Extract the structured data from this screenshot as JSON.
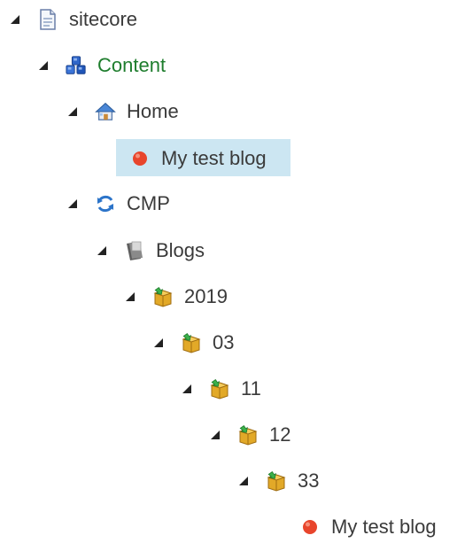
{
  "tree": {
    "sitecore": {
      "label": "sitecore",
      "icon": "document-icon"
    },
    "content": {
      "label": "Content",
      "icon": "cubes-icon",
      "label_color": "#1e7d2d"
    },
    "home": {
      "label": "Home",
      "icon": "house-icon"
    },
    "home_blog": {
      "label": "My test blog",
      "icon": "red-dot-icon",
      "selected": true
    },
    "cmp": {
      "label": "CMP",
      "icon": "sync-icon"
    },
    "blogs": {
      "label": "Blogs",
      "icon": "grey-folder-icon"
    },
    "y2019": {
      "label": "2019",
      "icon": "package-icon"
    },
    "m03": {
      "label": "03",
      "icon": "package-icon"
    },
    "d11": {
      "label": "11",
      "icon": "package-icon"
    },
    "h12": {
      "label": "12",
      "icon": "package-icon"
    },
    "n33": {
      "label": "33",
      "icon": "package-icon"
    },
    "cmp_blog": {
      "label": "My test blog",
      "icon": "red-dot-icon"
    }
  },
  "colors": {
    "selection_bg": "#cce6f2",
    "text": "#3a3a3a",
    "content_green": "#1e7d2d",
    "dot_red": "#e8452c"
  }
}
